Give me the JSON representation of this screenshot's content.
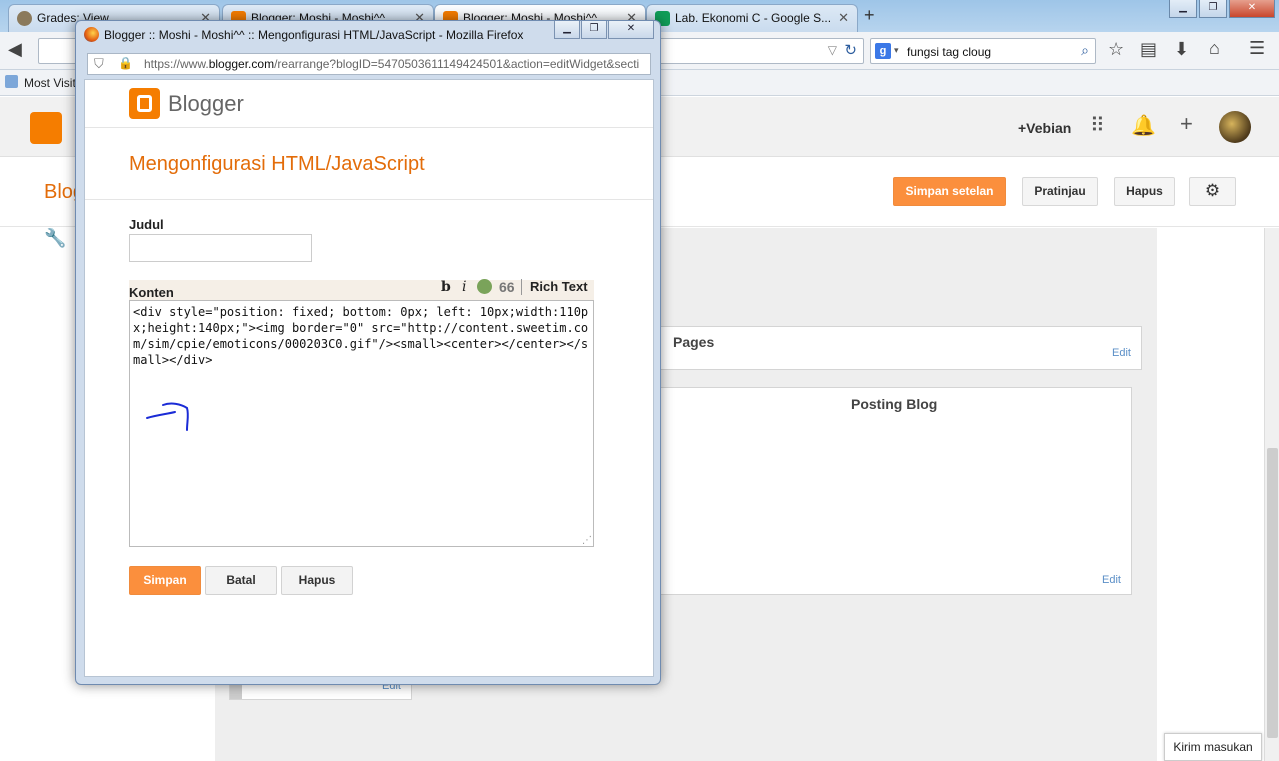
{
  "browser": {
    "tabs": [
      {
        "label": "Grades: View",
        "icon": "moodle-icon",
        "color": "#7a6a50",
        "active": false
      },
      {
        "label": "Blogger: Moshi - Moshi^^ ...",
        "icon": "blogger-icon",
        "color": "#f57d00",
        "active": false
      },
      {
        "label": "Blogger: Moshi - Moshi^^ ...",
        "icon": "blogger-icon",
        "color": "#f57d00",
        "active": true
      },
      {
        "label": "Lab. Ekonomi C - Google S...",
        "icon": "sheets-icon",
        "color": "#0f9d58",
        "active": false
      }
    ],
    "search_value": "fungsi tag cloug",
    "bookmarks_label": "Most Visit"
  },
  "blogger": {
    "user": "+Vebian",
    "blog_name": "Blog",
    "buttons": {
      "save_settings": "Simpan setelan",
      "preview": "Pratinjau",
      "delete": "Hapus"
    },
    "gadgets": {
      "pages": {
        "title": "Pages",
        "edit": "Edit"
      },
      "posts": {
        "title": "Posting Blog",
        "edit": "Edit"
      },
      "small": {
        "edit": "Edit"
      }
    },
    "feedback": "Kirim masukan",
    "brand_color": "#f57d00",
    "accent_color": "#fb8f3d"
  },
  "popup": {
    "window_title": "Blogger :: Moshi - Moshi^^ :: Mengonfigurasi HTML/JavaScript - Mozilla Firefox",
    "url_prefix": "https://www.",
    "url_domain": "blogger.com",
    "url_rest": "/rearrange?blogID=5470503611149424501&action=editWidget&secti",
    "brand": "Blogger",
    "heading": "Mengonfigurasi HTML/JavaScript",
    "title_label": "Judul",
    "title_value": "",
    "content_label": "Konten",
    "toolbar": {
      "bold": "b",
      "italic": "i",
      "quote": "66",
      "rich_text": "Rich Text"
    },
    "content_value": "<div style=\"position: fixed; bottom: 0px; left: 10px;width:110px;height:140px;\"><img border=\"0\" src=\"http://content.sweetim.com/sim/cpie/emoticons/000203C0.gif\"/><small><center></center></small></div>",
    "buttons": {
      "save": "Simpan",
      "cancel": "Batal",
      "delete": "Hapus"
    }
  }
}
